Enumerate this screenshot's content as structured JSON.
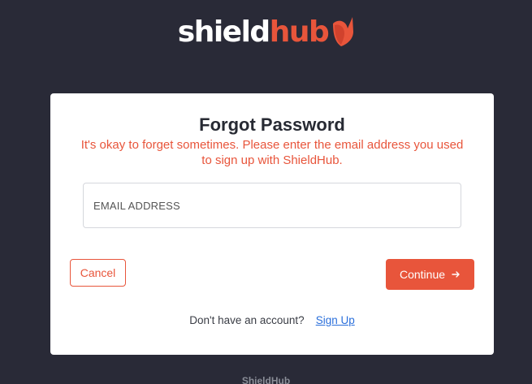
{
  "logo": {
    "part1": "shield",
    "part2": "hub",
    "mark_icon": "shield-heart-icon",
    "accent_color": "#e8553b"
  },
  "card": {
    "title": "Forgot Password",
    "subtitle": "It's okay to forget sometimes. Please enter the email address you used to sign up with ShieldHub."
  },
  "email": {
    "placeholder": "EMAIL ADDRESS",
    "value": ""
  },
  "buttons": {
    "cancel_label": "Cancel",
    "continue_label": "Continue",
    "continue_icon": "arrow-right-icon"
  },
  "signup": {
    "prompt": "Don't have an account?",
    "link_label": "Sign Up"
  },
  "footer": {
    "text": "ShieldHub"
  },
  "colors": {
    "background": "#292a37",
    "accent": "#e8553b",
    "link": "#2a6fdb"
  }
}
